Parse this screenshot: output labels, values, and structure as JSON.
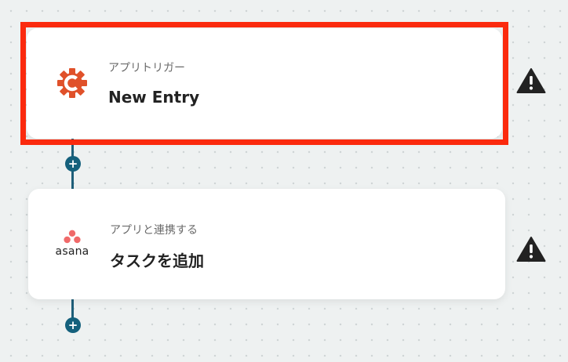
{
  "flow": {
    "steps": [
      {
        "subtitle": "アプリトリガー",
        "title": "New Entry",
        "app_icon": "cognito-forms-gear-icon",
        "status_icon": "warning-icon",
        "selected": true
      },
      {
        "subtitle": "アプリと連携する",
        "title": "タスクを追加",
        "app_icon": "asana-logo-icon",
        "app_icon_text": "asana",
        "status_icon": "warning-icon",
        "selected": false
      }
    ],
    "add_step_label": "+"
  },
  "colors": {
    "selection_outline": "#fb2a0e",
    "connector": "#14607c",
    "cognito_orange": "#e0512a",
    "asana_coral": "#f06a6a",
    "warning": "#222222"
  }
}
